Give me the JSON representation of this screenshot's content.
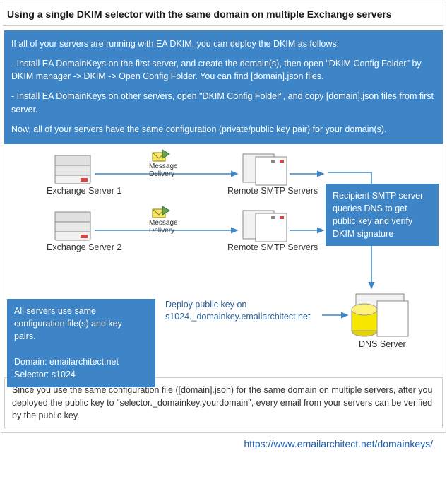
{
  "title": "Using a single DKIM selector with the same domain on multiple Exchange servers",
  "intro": {
    "p1": "If all of your servers are running with EA DKIM, you can deploy the DKIM as follows:",
    "p2": "-  Install EA DomainKeys on the first server, and create the domain(s), then open \"DKIM Config Folder\" by DKIM manager -> DKIM -> Open Config Folder. You can find [domain].json files.",
    "p3": "- Install EA DomainKeys on other servers, open \"DKIM Config Folder\", and copy [domain].json files from first server.",
    "p4": "Now, all of your servers have the same configuration (private/public key pair) for your domain(s)."
  },
  "diagram": {
    "ex1": "Exchange Server 1",
    "ex2": "Exchange Server 2",
    "msg": "Message\nDelivery",
    "remote1": "Remote SMTP Servers",
    "remote2": "Remote SMTP Servers",
    "dns": "DNS Server",
    "callout_right_l1": "Recipient SMTP server",
    "callout_right_l2": "queries DNS to get",
    "callout_right_l3": "public key and verify",
    "callout_right_l4": "DKIM signature",
    "callout_left_l1": "All servers use same",
    "callout_left_l2": "configuration file(s) and key",
    "callout_left_l3": "pairs.",
    "callout_left_l4": "Domain: emailarchitect.net",
    "callout_left_l5": "Selector: s1024",
    "deploy_l1": "Deploy public key on",
    "deploy_l2": "s1024._domainkey.emailarchitect.net"
  },
  "footer_box": "Since you use the same configuration file ([domain].json) for the same domain on multiple servers, after you deployed the public key to \"selector._domainkey.yourdomain\", every email from your servers can be verified by the public key.",
  "link": "https://www.emailarchitect.net/domainkeys/"
}
